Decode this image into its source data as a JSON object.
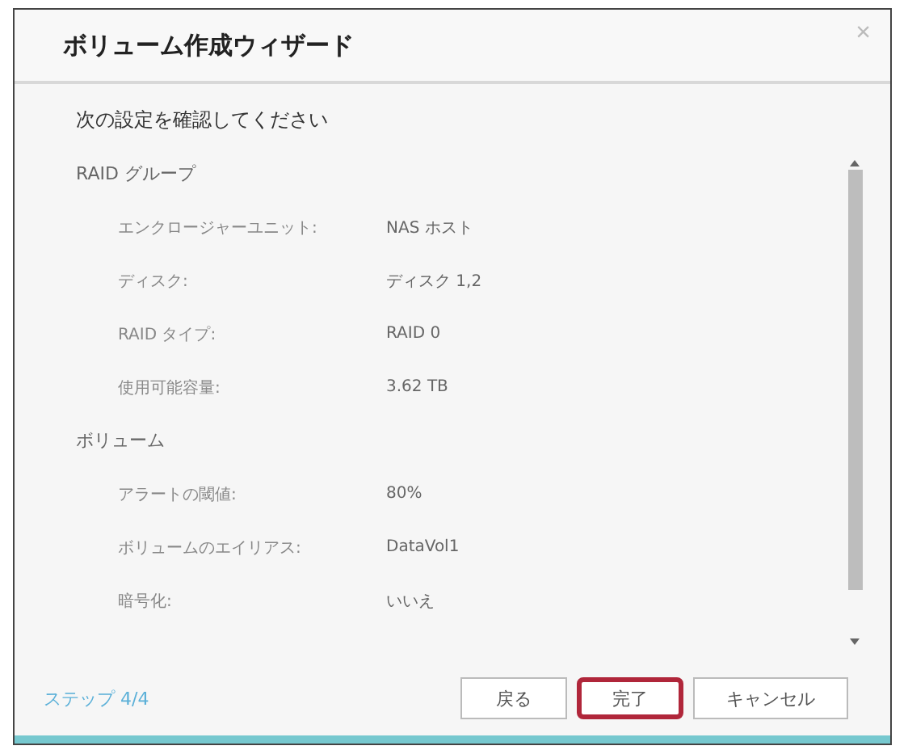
{
  "window": {
    "title": "ボリューム作成ウィザード",
    "close": "×"
  },
  "heading": "次の設定を確認してください",
  "sections": [
    {
      "title": "RAID グループ",
      "rows": [
        {
          "label": "エンクロージャーユニット:",
          "value": "NAS ホスト"
        },
        {
          "label": "ディスク:",
          "value": "ディスク 1,2"
        },
        {
          "label": "RAID タイプ:",
          "value": "RAID 0"
        },
        {
          "label": "使用可能容量:",
          "value": "3.62 TB"
        }
      ]
    },
    {
      "title": "ボリューム",
      "rows": [
        {
          "label": "アラートの閾値:",
          "value": "80%"
        },
        {
          "label": "ボリュームのエイリアス:",
          "value": "DataVol1"
        },
        {
          "label": "暗号化:",
          "value": "いいえ"
        }
      ]
    }
  ],
  "step": "ステップ 4/4",
  "buttons": [
    {
      "label": "戻る",
      "highlighted": false
    },
    {
      "label": "完了",
      "highlighted": true
    },
    {
      "label": "キャンセル",
      "highlighted": false
    }
  ]
}
